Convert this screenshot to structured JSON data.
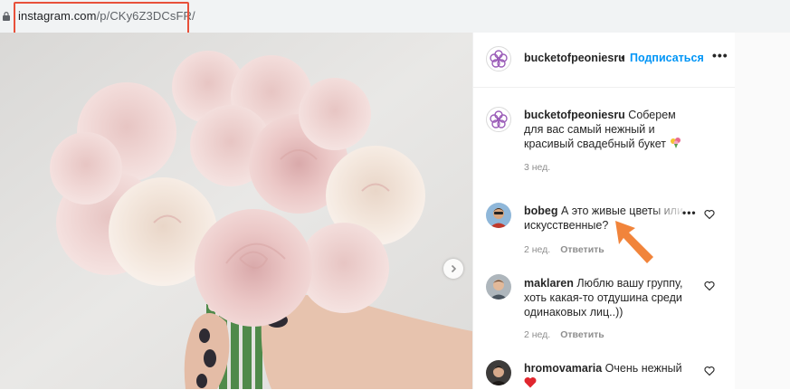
{
  "browser": {
    "url_main": "instagram.com",
    "url_path": "/p/CKy6Z3DCsFR/"
  },
  "post": {
    "username": "bucketofpeoniesru",
    "separator": "•",
    "follow_label": "Подписаться",
    "more_label": "•••"
  },
  "caption": {
    "username": "bucketofpeoniesru",
    "text": " Соберем для вас самый нежный и красивый свадебный букет",
    "time": "3 нед."
  },
  "comments": [
    {
      "username": "bobeg",
      "text": " А это живые цветы или искусственные?",
      "time": "2 нед.",
      "reply_label": "Ответить",
      "more_label": "•••"
    },
    {
      "username": "maklaren",
      "text": " Люблю вашу группу, хоть какая-то отдушина среди одинаковых лиц..))",
      "time": "2 нед.",
      "reply_label": "Ответить"
    },
    {
      "username": "hromovamaria",
      "text": " Очень нежный"
    }
  ],
  "icons": {
    "lock": "lock-icon",
    "next": "chevron-right-icon",
    "heart": "heart-outline-icon",
    "logo": "flower-logo-icon",
    "emoji_bouquet": "bouquet-emoji",
    "emoji_heart": "red-heart-emoji",
    "annotation": "orange-arrow-annotation"
  },
  "colors": {
    "follow": "#0095f6",
    "highlight": "#e8503a",
    "arrow": "#f07a2a",
    "logo_purple": "#9b5db8"
  }
}
